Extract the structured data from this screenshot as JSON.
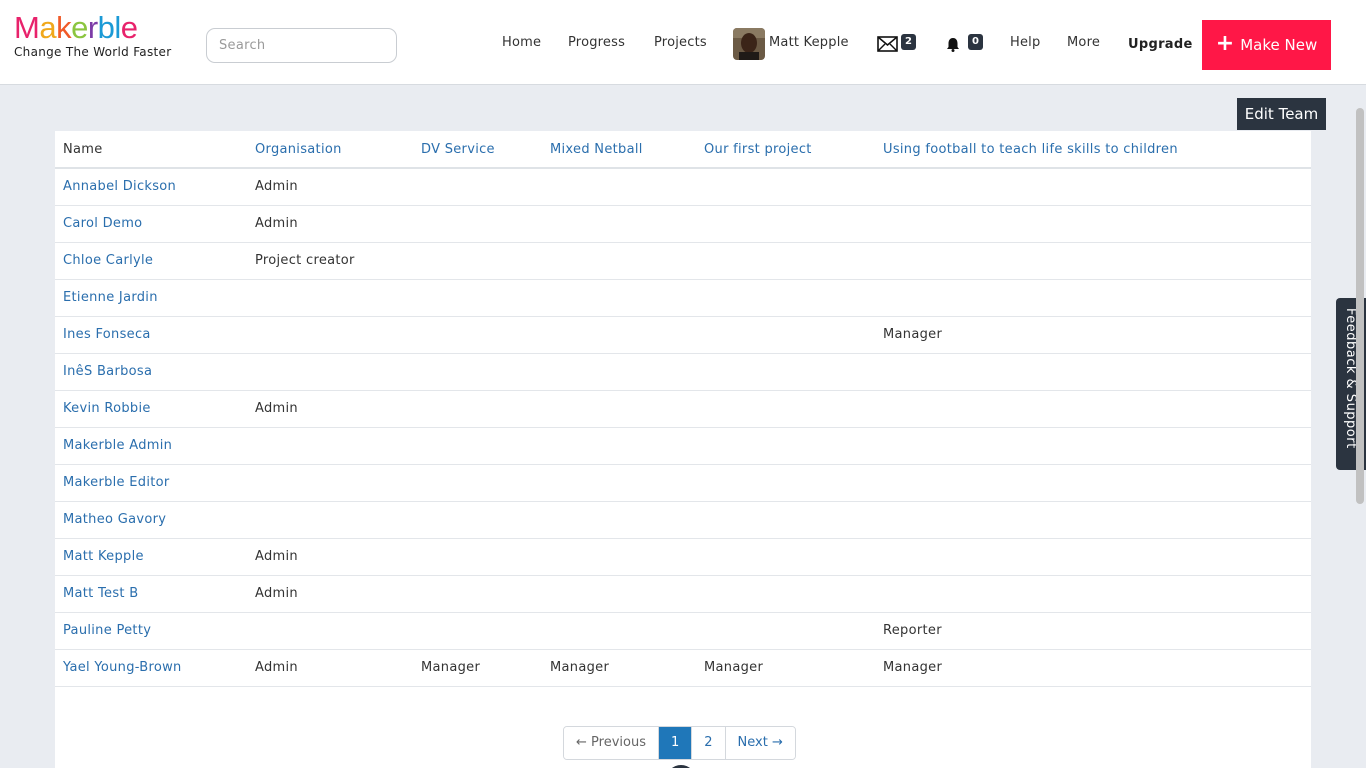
{
  "brand": {
    "logo_letters": [
      "M",
      "a",
      "k",
      "e",
      "r",
      "b",
      "l",
      "e"
    ],
    "logo_colors": [
      "#e8226b",
      "#f0a81c",
      "#f05a28",
      "#8bc53f",
      "#7b3ba6",
      "#1b9ad6",
      "#1b9ad6",
      "#e8226b"
    ],
    "tagline": "Change The World Faster"
  },
  "search": {
    "placeholder": "Search"
  },
  "nav": {
    "home": "Home",
    "progress": "Progress",
    "projects": "Projects",
    "user_name": "Matt Kepple",
    "messages_count": "2",
    "notifications_count": "0",
    "help": "Help",
    "more": "More",
    "upgrade": "Upgrade",
    "make_new": "Make New"
  },
  "edit_team_label": "Edit Team",
  "table": {
    "columns": [
      "Name",
      "Organisation",
      "DV Service",
      "Mixed Netball",
      "Our first project",
      "Using football to teach life skills to children"
    ],
    "rows": [
      [
        "Annabel Dickson",
        "Admin",
        "",
        "",
        "",
        ""
      ],
      [
        "Carol Demo",
        "Admin",
        "",
        "",
        "",
        ""
      ],
      [
        "Chloe Carlyle",
        "Project creator",
        "",
        "",
        "",
        ""
      ],
      [
        "Etienne Jardin",
        "",
        "",
        "",
        "",
        ""
      ],
      [
        "Ines Fonseca",
        "",
        "",
        "",
        "",
        "Manager"
      ],
      [
        "InêS Barbosa",
        "",
        "",
        "",
        "",
        ""
      ],
      [
        "Kevin Robbie",
        "Admin",
        "",
        "",
        "",
        ""
      ],
      [
        "Makerble Admin",
        "",
        "",
        "",
        "",
        ""
      ],
      [
        "Makerble Editor",
        "",
        "",
        "",
        "",
        ""
      ],
      [
        "Matheo Gavory",
        "",
        "",
        "",
        "",
        ""
      ],
      [
        "Matt Kepple",
        "Admin",
        "",
        "",
        "",
        ""
      ],
      [
        "Matt Test B",
        "Admin",
        "",
        "",
        "",
        ""
      ],
      [
        "Pauline Petty",
        "",
        "",
        "",
        "",
        "Reporter"
      ],
      [
        "Yael Young-Brown",
        "Admin",
        "Manager",
        "Manager",
        "Manager",
        "Manager"
      ]
    ]
  },
  "pagination": {
    "previous": "← Previous",
    "pages": [
      "1",
      "2"
    ],
    "current": "1",
    "next": "Next →"
  },
  "feedback_label": "Feedback & Support",
  "colors": {
    "accent": "#ff1747",
    "dark": "#2b3440",
    "link": "#2a6ead",
    "page_active": "#1f77b9"
  }
}
